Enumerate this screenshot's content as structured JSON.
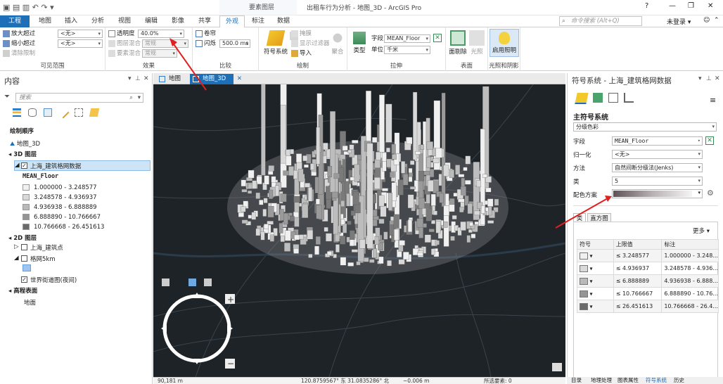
{
  "window": {
    "title": "出租车行为分析 - 地图_3D - ArcGIS Pro",
    "context_tab_group": "要素图层",
    "help": "?",
    "minimize": "—",
    "restore": "❐",
    "close": "✕"
  },
  "search_box": {
    "placeholder": "命令搜索 (Alt+Q)"
  },
  "user": {
    "label": "未登录 ▾"
  },
  "tabs": [
    "工程",
    "地图",
    "插入",
    "分析",
    "视图",
    "编辑",
    "影像",
    "共享",
    "外观",
    "标注",
    "数据"
  ],
  "ribbon": {
    "nav": {
      "zoom_in": "放大超过",
      "zoom_out": "缩小超过",
      "clear": "清除限制",
      "zoom_in_val": "<无>",
      "zoom_out_val": "<无>",
      "label": "可见范围"
    },
    "effects": {
      "transparency_label": "透明度",
      "transparency_value": "40.0%",
      "blend_label": "图层混合",
      "blend_value": "常规",
      "feature_blend_label": "要素混合",
      "feature_blend_value": "常规",
      "label": "效果"
    },
    "compare": {
      "swipe": "卷帘",
      "flicker": "闪烁",
      "flicker_value": "500.0",
      "flicker_unit": "ms",
      "label": "比较"
    },
    "drawing": {
      "symbology": "符号系统",
      "vary_by": "",
      "masking": "掩膜",
      "display_filters": "显示过滤器",
      "import": "导入",
      "aggregate": "聚合",
      "label": "绘制"
    },
    "extrusion": {
      "type": "类型",
      "field_label": "字段",
      "field_value": "MEAN_Floor",
      "unit_label": "单位",
      "unit_value": "千米",
      "label": "拉伸"
    },
    "faces": {
      "face_culling": "面剔除",
      "lighting": "光照",
      "label": "表面"
    },
    "lighting": {
      "enable": "启用照明",
      "label": "光照和阴影"
    }
  },
  "contents_pane": {
    "title": "内容",
    "search_placeholder": "搜索",
    "drawing_order": "绘制顺序",
    "map_name": "地图_3D",
    "group_3d": "3D 图层",
    "layer_3d": "上海_建筑格网数据",
    "field": "MEAN_Floor",
    "classes": [
      {
        "label": "1.000000 - 3.248577",
        "color": "#f1f1f1"
      },
      {
        "label": "3.248578 - 4.936937",
        "color": "#d9d9d9"
      },
      {
        "label": "4.936938 - 6.888889",
        "color": "#b9b9b9"
      },
      {
        "label": "6.888890 - 10.766667",
        "color": "#959595"
      },
      {
        "label": "10.766668 - 26.451613",
        "color": "#6a6a6a"
      }
    ],
    "group_2d": "2D 图层",
    "layer_points": "上海_建筑点",
    "layer_grid": "格网5km",
    "grid_color": "#9ec4ef",
    "layer_basemap": "世界街道图(夜间)",
    "elevation": "高程表面",
    "ground": "地面"
  },
  "view_tabs": [
    {
      "label": "地图"
    },
    {
      "label": "地图_3D"
    }
  ],
  "status_bar": {
    "scale": "90,181 m",
    "coords": "120.8759567° 东 31.0835286° 北",
    "elevation": "~0.006 m",
    "selected": "所选要素: 0"
  },
  "symbology_pane": {
    "title": "符号系统 - 上海_建筑格网数据",
    "primary": "主符号系统",
    "method_type": "分级色彩",
    "field_label": "字段",
    "field_value": "MEAN_Floor",
    "normalize_label": "归一化",
    "normalize_value": "<无>",
    "method_label": "方法",
    "method_value": "自然间断分级法(Jenks)",
    "classes_label": "类",
    "classes_value": "5",
    "scheme_label": "配色方案",
    "tab_classes": "类",
    "tab_histogram": "直方图",
    "more": "更多",
    "col_symbol": "符号",
    "col_upper": "上限值",
    "col_label": "标注",
    "rows": [
      {
        "op": "≤",
        "upper": "3.248577",
        "label": "1.000000 - 3.248...",
        "color": "#f1f1f1"
      },
      {
        "op": "≤",
        "upper": "4.936937",
        "label": "3.248578 - 4.936...",
        "color": "#d9d9d9"
      },
      {
        "op": "≤",
        "upper": "6.888889",
        "label": "4.936938 - 6.888...",
        "color": "#b9b9b9"
      },
      {
        "op": "≤",
        "upper": "10.766667",
        "label": "6.888890 - 10.76...",
        "color": "#959595"
      },
      {
        "op": "≤",
        "upper": "26.451613",
        "label": "10.766668 - 26.4...",
        "color": "#6a6a6a"
      }
    ]
  },
  "bottom_tabs": [
    "目录",
    "地理处理",
    "图表属性",
    "符号系统",
    "历史"
  ],
  "colors": {
    "accent": "#1d6fb8",
    "arrow": "#e02020"
  }
}
